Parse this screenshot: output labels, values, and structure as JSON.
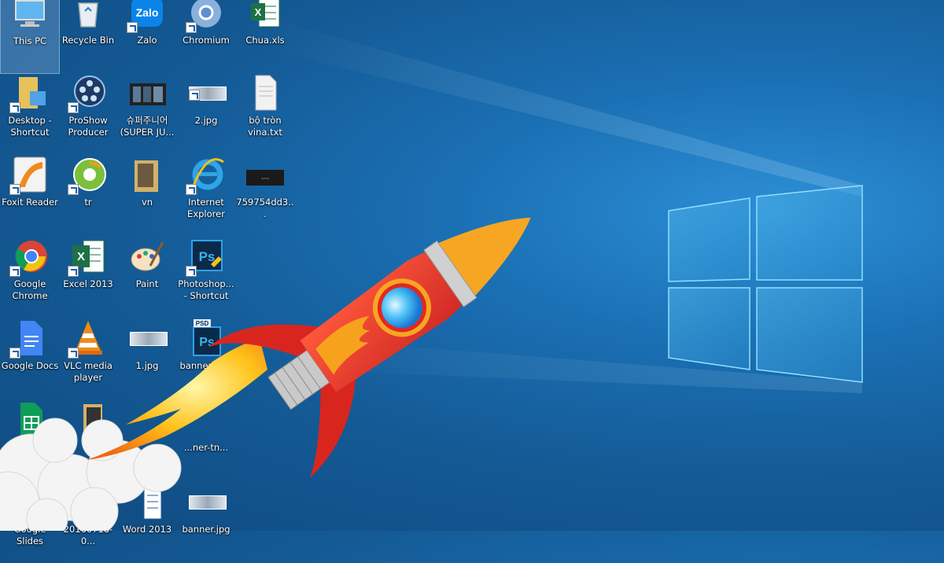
{
  "desktop": {
    "icons": [
      {
        "label": "This PC"
      },
      {
        "label": "Recycle Bin"
      },
      {
        "label": "Zalo"
      },
      {
        "label": "Chromium"
      },
      {
        "label": "Chua.xls"
      },
      {
        "label": "Desktop - Shortcut"
      },
      {
        "label": "ProShow Producer"
      },
      {
        "label": "슈퍼주니어 (SUPER JU..."
      },
      {
        "label": "2.jpg"
      },
      {
        "label": "bộ tròn vina.txt"
      },
      {
        "label": "Foxit Reader"
      },
      {
        "label": "tr"
      },
      {
        "label": "vn"
      },
      {
        "label": "Internet Explorer"
      },
      {
        "label": "759754dd3..."
      },
      {
        "label": "Google Chrome"
      },
      {
        "label": "Excel 2013"
      },
      {
        "label": "Paint"
      },
      {
        "label": "Photoshop... - Shortcut"
      },
      {
        "label": "Google Docs"
      },
      {
        "label": "VLC media player"
      },
      {
        "label": "1.jpg"
      },
      {
        "label": "banner-tn..."
      },
      {
        "label": "...ner-tn..."
      },
      {
        "label": "Google Slides"
      },
      {
        "label": "20160718-0..."
      },
      {
        "label": "Word 2013"
      },
      {
        "label": "banner.jpg"
      }
    ],
    "zalo_text": "Zalo",
    "excel_letter": "X",
    "ps_letters": "Ps",
    "psd_tag": "PSD"
  },
  "colors": {
    "accent": "#1a6fb3",
    "rocket_body": "#e8322b",
    "rocket_nose": "#f6a623",
    "window_logo": "#7fd4f2"
  }
}
